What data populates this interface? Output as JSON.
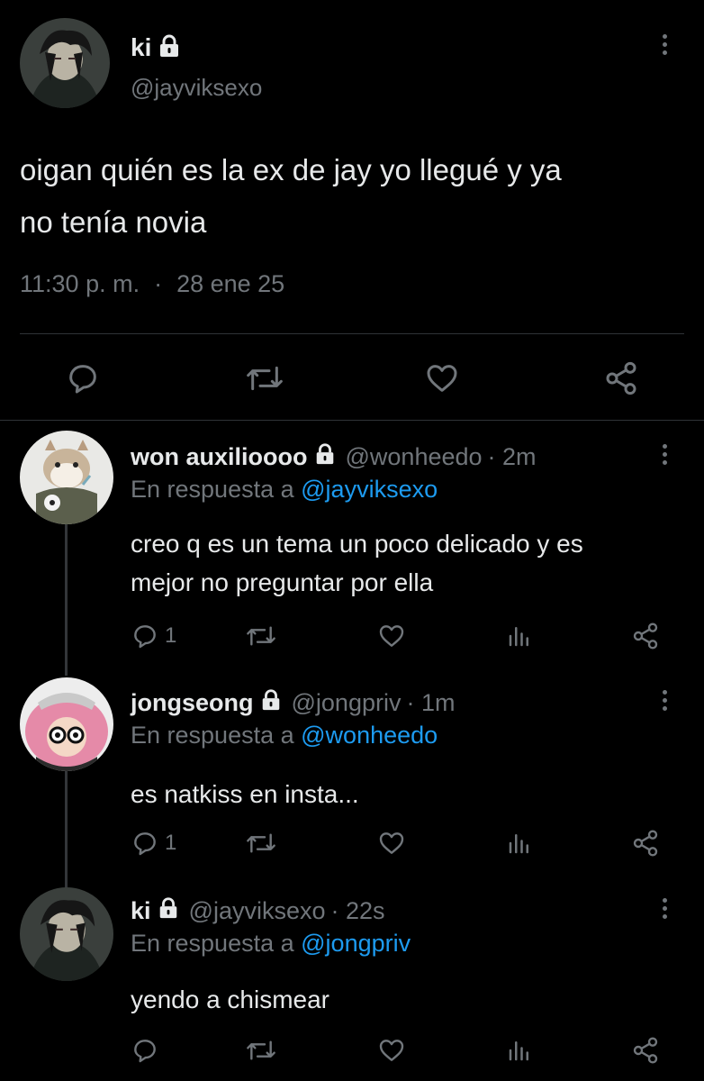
{
  "main_tweet": {
    "display_name": "ki",
    "handle": "@jayviksexo",
    "text_line1": "oigan quién es la ex de jay yo llegué y ya",
    "text_line2": "no tenía novia",
    "time": "11:30 p. m.",
    "separator": "·",
    "date": "28 ene 25"
  },
  "replies": [
    {
      "display_name": "won auxilioooo",
      "handle": "@wonheedo",
      "age": "· 2m",
      "reply_prefix": "En respuesta a",
      "reply_to": "@jayviksexo",
      "text_line1": "creo q es un tema un poco delicado y es",
      "text_line2": "mejor no preguntar por ella",
      "reply_count": "1"
    },
    {
      "display_name": "jongseong",
      "handle": "@jongpriv",
      "age": "· 1m",
      "reply_prefix": "En respuesta a",
      "reply_to": "@wonheedo",
      "text_line1": "es natkiss en insta...",
      "reply_count": "1"
    },
    {
      "display_name": "ki",
      "handle": "@jayviksexo",
      "age": "· 22s",
      "reply_prefix": "En respuesta a",
      "reply_to": "@jongpriv",
      "text_line1": "yendo a chismear",
      "reply_count": ""
    }
  ],
  "colors": {
    "background": "#000000",
    "text": "#e7e9ea",
    "muted": "#71767b",
    "link": "#1d9bf0"
  },
  "icons": [
    "lock-icon",
    "more-icon",
    "reply-icon",
    "retweet-icon",
    "like-icon",
    "share-icon",
    "views-icon"
  ]
}
